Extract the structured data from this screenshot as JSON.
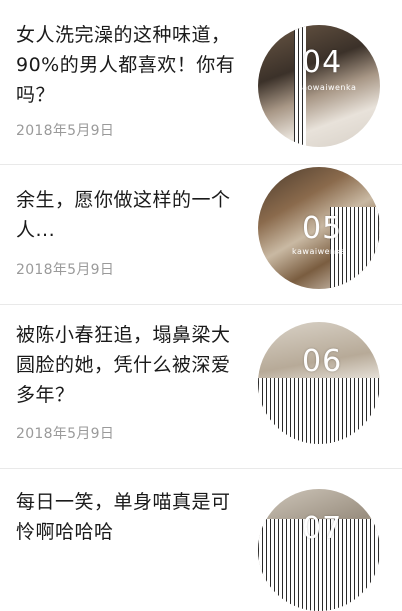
{
  "articles": [
    {
      "title": "女人洗完澡的这种味道，90%的男人都喜欢！你有吗？",
      "date": "2018年5月9日",
      "thumb": {
        "number": "04",
        "caption": "aowaiwenka"
      }
    },
    {
      "title": "余生，愿你做这样的一个人...",
      "date": "2018年5月9日",
      "thumb": {
        "number": "05",
        "caption": "kawaiwenka"
      }
    },
    {
      "title": "被陈小春狂追，塌鼻梁大圆脸的她，凭什么被深爱多年？",
      "date": "2018年5月9日",
      "thumb": {
        "number": "06",
        "caption": ""
      }
    },
    {
      "title": "每日一笑，单身喵真是可怜啊哈哈哈",
      "date": "",
      "thumb": {
        "number": "07",
        "caption": ""
      }
    }
  ]
}
